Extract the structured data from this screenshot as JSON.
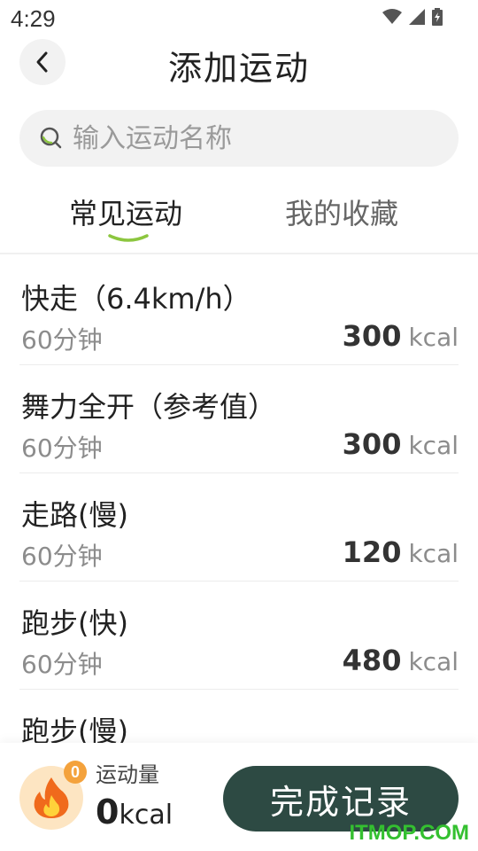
{
  "status_bar": {
    "time": "4:29"
  },
  "header": {
    "title": "添加运动"
  },
  "search": {
    "placeholder": "输入运动名称",
    "value": ""
  },
  "tabs": [
    {
      "label": "常见运动",
      "active": true
    },
    {
      "label": "我的收藏",
      "active": false
    }
  ],
  "exercises": [
    {
      "name": "快走（6.4km/h）",
      "duration": "60分钟",
      "kcal": "300",
      "unit": "kcal"
    },
    {
      "name": "舞力全开（参考值）",
      "duration": "60分钟",
      "kcal": "300",
      "unit": "kcal"
    },
    {
      "name": "走路(慢)",
      "duration": "60分钟",
      "kcal": "120",
      "unit": "kcal"
    },
    {
      "name": "跑步(快)",
      "duration": "60分钟",
      "kcal": "480",
      "unit": "kcal"
    },
    {
      "name": "跑步(慢)",
      "duration": "",
      "kcal": "",
      "unit": ""
    }
  ],
  "summary": {
    "count_badge": "0",
    "label": "运动量",
    "value": "0",
    "unit": "kcal"
  },
  "finish_button": {
    "label": "完成记录"
  },
  "watermark": "ITMOP.COM",
  "colors": {
    "accent_green": "#8cc63f",
    "button_dark": "#2d4a43",
    "badge_orange": "#f4a23c",
    "fire_bg": "#fde5c2"
  }
}
